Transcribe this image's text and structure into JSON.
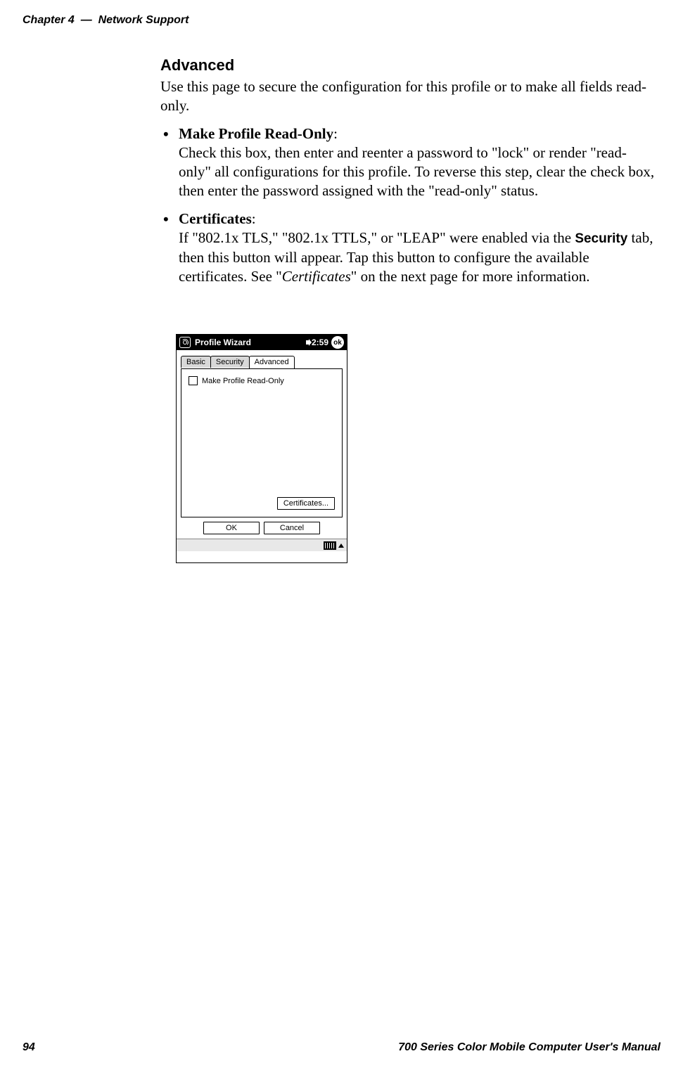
{
  "header": {
    "chapter_label": "Chapter 4",
    "separator": "—",
    "chapter_title": "Network Support"
  },
  "section": {
    "title": "Advanced",
    "intro": "Use this page to secure the configuration for this profile or to make all fields read-only."
  },
  "bullets": [
    {
      "label": "Make Profile Read-Only",
      "body": "Check this box, then enter and reenter a password to \"lock\" or render \"read-only\" all configurations for this profile. To reverse this step, clear the check box, then enter the password assigned with the \"read-only\" status."
    },
    {
      "label": "Certificates",
      "body_a": "If \"802.1x TLS,\" \"802.1x TTLS,\" or \"LEAP\" were enabled via the ",
      "body_b_sansbold": "Security",
      "body_c": " tab, then this button will appear. Tap this button to configure the available certificates. See \"",
      "body_d_italic": "Certificates",
      "body_e": "\" on the next page for more information."
    }
  ],
  "wizard": {
    "title": "Profile Wizard",
    "time": "2:59",
    "ok_badge": "ok",
    "tabs": {
      "basic": "Basic",
      "security": "Security",
      "advanced": "Advanced"
    },
    "checkbox_label": "Make Profile Read-Only",
    "cert_button": "Certificates...",
    "ok_button": "OK",
    "cancel_button": "Cancel"
  },
  "footer": {
    "page_number": "94",
    "book_title": "700 Series Color Mobile Computer User's Manual"
  }
}
